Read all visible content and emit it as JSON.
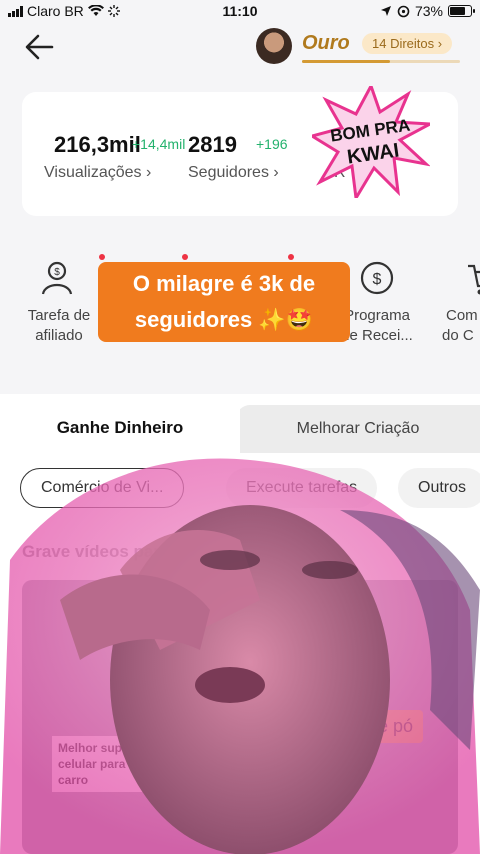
{
  "status_bar": {
    "carrier": "Claro BR",
    "time": "11:10",
    "battery": "73%"
  },
  "header": {
    "level_name": "Ouro",
    "rights_label": "14 Direitos",
    "level_progress": 0.56
  },
  "stats": {
    "views": {
      "value": "216,3mil",
      "delta": "+14,4mil",
      "label": "Visualizações"
    },
    "followers": {
      "value": "2819",
      "delta": "+196",
      "label": "Seguidores"
    },
    "third_label_partial": "R"
  },
  "sticker": {
    "line1": "BOM PRA",
    "line2": "KWAI"
  },
  "tools": [
    {
      "label_line1": "Tarefa de",
      "label_line2": "afiliado",
      "icon": "user-dollar-icon",
      "badge": true
    },
    {
      "label_line1": "Programa",
      "label_line2": "de Recei...",
      "icon": "dollar-coin-icon",
      "badge": false
    },
    {
      "label_line1": "Com",
      "label_line2": "do C",
      "icon": "cart-icon",
      "badge": false
    }
  ],
  "caption": {
    "line1": "O milagre é 3k de",
    "line2": "seguidores ✨🤩"
  },
  "tabs": {
    "active": "Ganhe Dinheiro",
    "inactive": "Melhorar Criação"
  },
  "chips": [
    "Comércio de Vi...",
    "Execute tarefas",
    "Outros"
  ],
  "section_title": "Grave vídeos para ... produtos",
  "video_card": {
    "label_line1": "Melhor suport",
    "label_line2": "celular para carro",
    "tag": "de pó"
  },
  "colors": {
    "accent": "#f07b1e",
    "gold": "#b07a1e",
    "positive": "#23b26d",
    "badge": "#ee3344",
    "sticker_pink": "#e8338f"
  }
}
